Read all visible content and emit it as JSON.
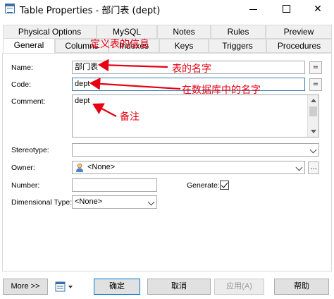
{
  "window": {
    "title": "Table Properties - 部门表 (dept)",
    "minimize_glyph": "",
    "maximize_glyph": "",
    "close_glyph": "✕"
  },
  "tabs": {
    "row_back": [
      {
        "label": "Physical Options"
      },
      {
        "label": "MySQL"
      },
      {
        "label": "Notes"
      },
      {
        "label": "Rules"
      },
      {
        "label": "Preview"
      }
    ],
    "row_front": [
      {
        "label": "General",
        "active": true
      },
      {
        "label": "Columns"
      },
      {
        "label": "Indexes"
      },
      {
        "label": "Keys"
      },
      {
        "label": "Triggers"
      },
      {
        "label": "Procedures"
      }
    ]
  },
  "form": {
    "name_label": "Name:",
    "name_value": "部门表",
    "code_label": "Code:",
    "code_value": "dept",
    "comment_label": "Comment:",
    "comment_value": "dept",
    "stereotype_label": "Stereotype:",
    "stereotype_value": "",
    "owner_label": "Owner:",
    "owner_value": "<None>",
    "number_label": "Number:",
    "number_value": "",
    "generate_label": "Generate:",
    "generate_checked": true,
    "dimensional_type_label": "Dimensional Type:",
    "dimensional_type_value": "<None>",
    "equals_glyph": "=",
    "ellipsis_glyph": "..."
  },
  "buttons": {
    "more": "More >>",
    "ok": "确定",
    "cancel": "取消",
    "apply": "应用(A)",
    "help": "帮助"
  },
  "annotations": {
    "define_table_info": "定义表的信息",
    "table_name": "表的名字",
    "db_name": "在数据库中的名字",
    "remark": "备注",
    "color": "#e60012"
  },
  "icons": {
    "app": "table-icon",
    "owner": "user-icon",
    "options": "options-dropdown-icon"
  }
}
